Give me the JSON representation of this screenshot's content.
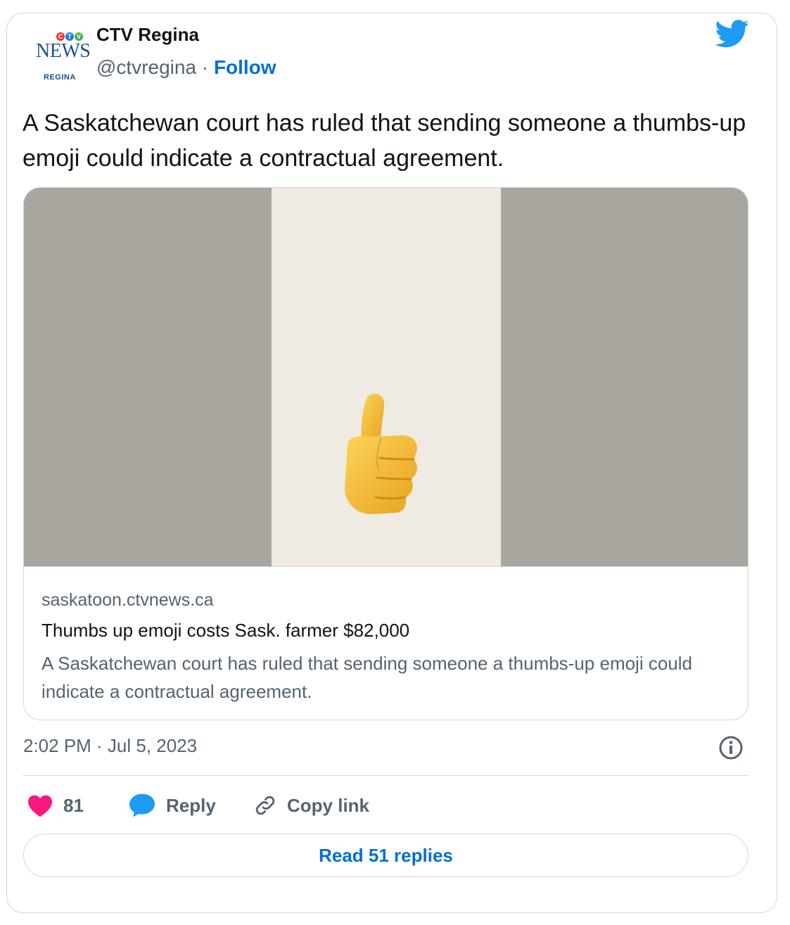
{
  "author": {
    "name": "CTV Regina",
    "handle": "@ctvregina",
    "separator": " · ",
    "follow_label": "Follow",
    "logo": {
      "letters": [
        "C",
        "T",
        "V"
      ],
      "wordmark": "NEWS",
      "subtitle": "REGINA"
    }
  },
  "tweet": {
    "text": "A Saskatchewan court has ruled that sending someone a thumbs-up emoji could indicate a contractual agreement.",
    "timestamp": "2:02 PM · Jul 5, 2023"
  },
  "card": {
    "domain": "saskatoon.ctvnews.ca",
    "title": "Thumbs up emoji costs Sask. farmer $82,000",
    "description": "A Saskatchewan court has ruled that sending someone a thumbs-up emoji could indicate a contractual agreement.",
    "image_icon": "thumbs-up-emoji"
  },
  "actions": {
    "like_count": "81",
    "reply_label": "Reply",
    "copy_label": "Copy link"
  },
  "read_replies_label": "Read 51 replies",
  "colors": {
    "twitter_blue": "#1d9bf0",
    "link_blue": "#006fd6",
    "heart": "#f91880",
    "text_primary": "#0f1419",
    "text_secondary": "#536471",
    "border": "#cfd9de",
    "card_bg_side": "#a8a69f",
    "card_bg_center": "#efebe2",
    "emoji_yellow": "#f5c242"
  }
}
